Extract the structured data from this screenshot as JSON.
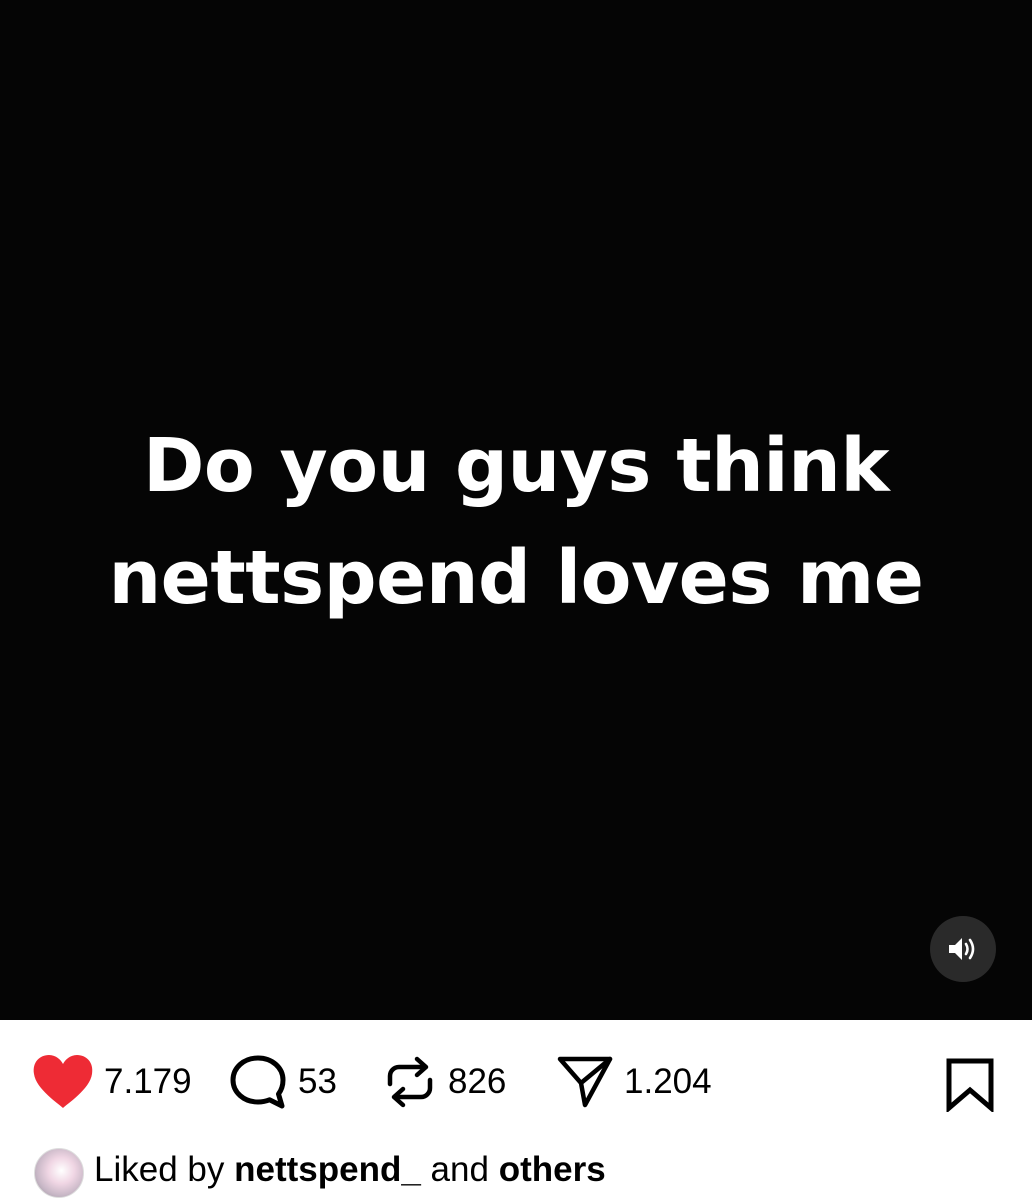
{
  "post": {
    "caption_line1": "Do you guys think",
    "caption_line2": "nettspend loves me"
  },
  "actions": {
    "likes": "7.179",
    "comments": "53",
    "reposts": "826",
    "shares": "1.204"
  },
  "liked_by": {
    "prefix": "Liked by",
    "user": "nettspend_",
    "middle": "and",
    "suffix": "others"
  },
  "colors": {
    "media_bg": "#050505",
    "heart": "#ee2b35",
    "text": "#000000"
  },
  "icons": {
    "sound": "speaker-on-icon",
    "like": "heart-filled-icon",
    "comment": "comment-bubble-icon",
    "repost": "repost-icon",
    "share": "send-paper-plane-icon",
    "save": "bookmark-icon"
  }
}
